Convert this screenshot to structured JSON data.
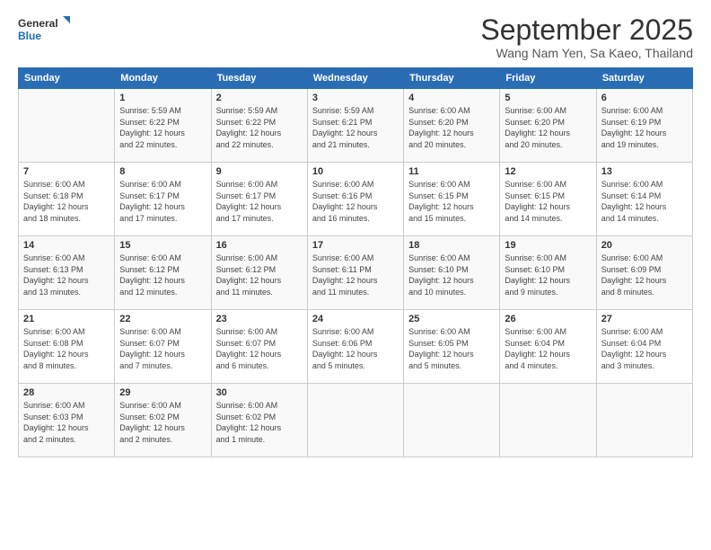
{
  "logo": {
    "line1": "General",
    "line2": "Blue"
  },
  "title": "September 2025",
  "location": "Wang Nam Yen, Sa Kaeo, Thailand",
  "headers": [
    "Sunday",
    "Monday",
    "Tuesday",
    "Wednesday",
    "Thursday",
    "Friday",
    "Saturday"
  ],
  "weeks": [
    [
      {
        "day": "",
        "info": ""
      },
      {
        "day": "1",
        "info": "Sunrise: 5:59 AM\nSunset: 6:22 PM\nDaylight: 12 hours\nand 22 minutes."
      },
      {
        "day": "2",
        "info": "Sunrise: 5:59 AM\nSunset: 6:22 PM\nDaylight: 12 hours\nand 22 minutes."
      },
      {
        "day": "3",
        "info": "Sunrise: 5:59 AM\nSunset: 6:21 PM\nDaylight: 12 hours\nand 21 minutes."
      },
      {
        "day": "4",
        "info": "Sunrise: 6:00 AM\nSunset: 6:20 PM\nDaylight: 12 hours\nand 20 minutes."
      },
      {
        "day": "5",
        "info": "Sunrise: 6:00 AM\nSunset: 6:20 PM\nDaylight: 12 hours\nand 20 minutes."
      },
      {
        "day": "6",
        "info": "Sunrise: 6:00 AM\nSunset: 6:19 PM\nDaylight: 12 hours\nand 19 minutes."
      }
    ],
    [
      {
        "day": "7",
        "info": "Sunrise: 6:00 AM\nSunset: 6:18 PM\nDaylight: 12 hours\nand 18 minutes."
      },
      {
        "day": "8",
        "info": "Sunrise: 6:00 AM\nSunset: 6:17 PM\nDaylight: 12 hours\nand 17 minutes."
      },
      {
        "day": "9",
        "info": "Sunrise: 6:00 AM\nSunset: 6:17 PM\nDaylight: 12 hours\nand 17 minutes."
      },
      {
        "day": "10",
        "info": "Sunrise: 6:00 AM\nSunset: 6:16 PM\nDaylight: 12 hours\nand 16 minutes."
      },
      {
        "day": "11",
        "info": "Sunrise: 6:00 AM\nSunset: 6:15 PM\nDaylight: 12 hours\nand 15 minutes."
      },
      {
        "day": "12",
        "info": "Sunrise: 6:00 AM\nSunset: 6:15 PM\nDaylight: 12 hours\nand 14 minutes."
      },
      {
        "day": "13",
        "info": "Sunrise: 6:00 AM\nSunset: 6:14 PM\nDaylight: 12 hours\nand 14 minutes."
      }
    ],
    [
      {
        "day": "14",
        "info": "Sunrise: 6:00 AM\nSunset: 6:13 PM\nDaylight: 12 hours\nand 13 minutes."
      },
      {
        "day": "15",
        "info": "Sunrise: 6:00 AM\nSunset: 6:12 PM\nDaylight: 12 hours\nand 12 minutes."
      },
      {
        "day": "16",
        "info": "Sunrise: 6:00 AM\nSunset: 6:12 PM\nDaylight: 12 hours\nand 11 minutes."
      },
      {
        "day": "17",
        "info": "Sunrise: 6:00 AM\nSunset: 6:11 PM\nDaylight: 12 hours\nand 11 minutes."
      },
      {
        "day": "18",
        "info": "Sunrise: 6:00 AM\nSunset: 6:10 PM\nDaylight: 12 hours\nand 10 minutes."
      },
      {
        "day": "19",
        "info": "Sunrise: 6:00 AM\nSunset: 6:10 PM\nDaylight: 12 hours\nand 9 minutes."
      },
      {
        "day": "20",
        "info": "Sunrise: 6:00 AM\nSunset: 6:09 PM\nDaylight: 12 hours\nand 8 minutes."
      }
    ],
    [
      {
        "day": "21",
        "info": "Sunrise: 6:00 AM\nSunset: 6:08 PM\nDaylight: 12 hours\nand 8 minutes."
      },
      {
        "day": "22",
        "info": "Sunrise: 6:00 AM\nSunset: 6:07 PM\nDaylight: 12 hours\nand 7 minutes."
      },
      {
        "day": "23",
        "info": "Sunrise: 6:00 AM\nSunset: 6:07 PM\nDaylight: 12 hours\nand 6 minutes."
      },
      {
        "day": "24",
        "info": "Sunrise: 6:00 AM\nSunset: 6:06 PM\nDaylight: 12 hours\nand 5 minutes."
      },
      {
        "day": "25",
        "info": "Sunrise: 6:00 AM\nSunset: 6:05 PM\nDaylight: 12 hours\nand 5 minutes."
      },
      {
        "day": "26",
        "info": "Sunrise: 6:00 AM\nSunset: 6:04 PM\nDaylight: 12 hours\nand 4 minutes."
      },
      {
        "day": "27",
        "info": "Sunrise: 6:00 AM\nSunset: 6:04 PM\nDaylight: 12 hours\nand 3 minutes."
      }
    ],
    [
      {
        "day": "28",
        "info": "Sunrise: 6:00 AM\nSunset: 6:03 PM\nDaylight: 12 hours\nand 2 minutes."
      },
      {
        "day": "29",
        "info": "Sunrise: 6:00 AM\nSunset: 6:02 PM\nDaylight: 12 hours\nand 2 minutes."
      },
      {
        "day": "30",
        "info": "Sunrise: 6:00 AM\nSunset: 6:02 PM\nDaylight: 12 hours\nand 1 minute."
      },
      {
        "day": "",
        "info": ""
      },
      {
        "day": "",
        "info": ""
      },
      {
        "day": "",
        "info": ""
      },
      {
        "day": "",
        "info": ""
      }
    ]
  ]
}
